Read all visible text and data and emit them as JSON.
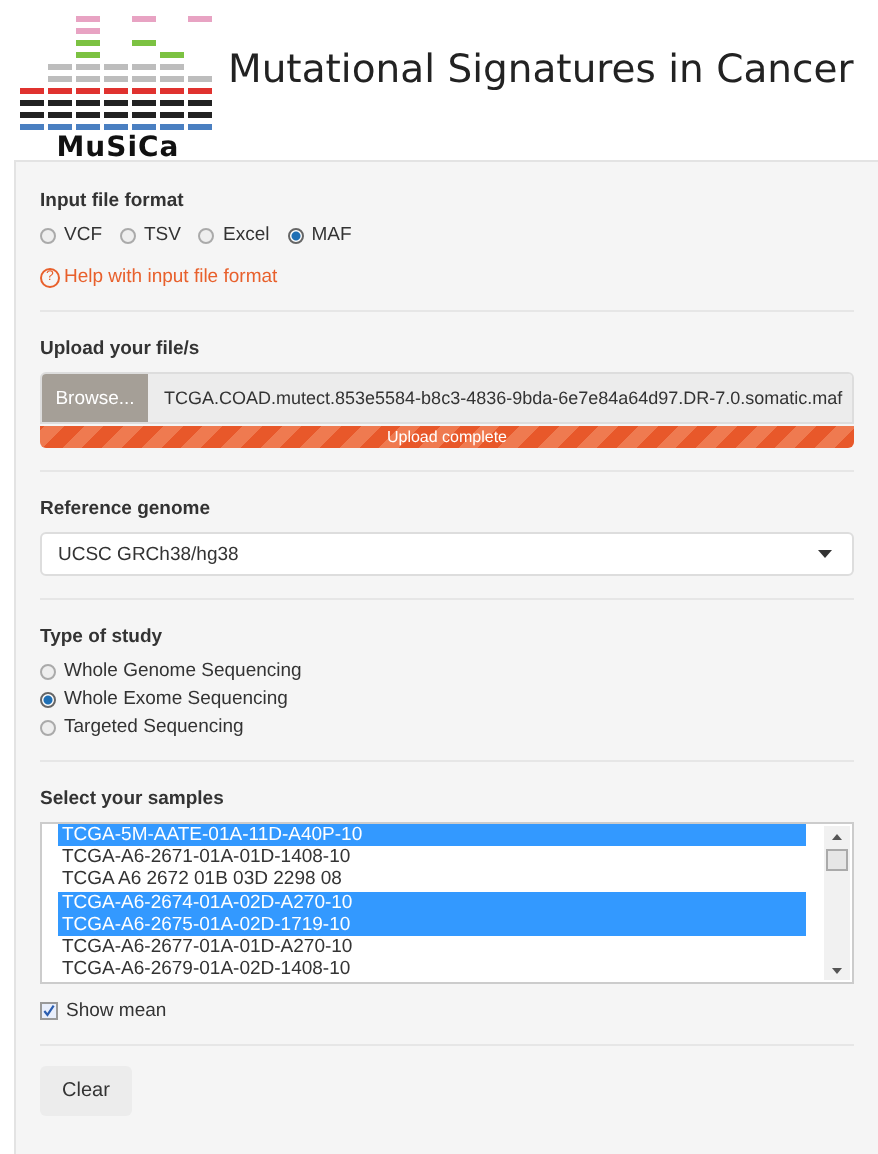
{
  "header": {
    "logo_text": "MuSiCa",
    "title": "Mutational Signatures in Cancer"
  },
  "input_format": {
    "label": "Input file format",
    "options": [
      {
        "label": "VCF",
        "selected": false
      },
      {
        "label": "TSV",
        "selected": false
      },
      {
        "label": "Excel",
        "selected": false
      },
      {
        "label": "MAF",
        "selected": true
      }
    ],
    "help_icon": "?",
    "help_link": "Help with input file format"
  },
  "upload": {
    "label": "Upload your file/s",
    "button": "Browse...",
    "file_name": "TCGA.COAD.mutect.853e5584-b8c3-4836-9bda-6e7e84a64d97.DR-7.0.somatic.maf",
    "progress": {
      "level": 1,
      "text": "Upload complete"
    }
  },
  "reference_genome": {
    "label": "Reference genome",
    "value": "UCSC GRCh38/hg38"
  },
  "study_type": {
    "label": "Type of study",
    "options": [
      {
        "label": "Whole Genome Sequencing",
        "selected": false
      },
      {
        "label": "Whole Exome Sequencing",
        "selected": true
      },
      {
        "label": "Targeted Sequencing",
        "selected": false
      }
    ]
  },
  "samples": {
    "label": "Select your samples",
    "items": [
      {
        "label": "TCGA-5M-AATE-01A-11D-A40P-10",
        "selected": true
      },
      {
        "label": "TCGA-A6-2671-01A-01D-1408-10",
        "selected": false
      },
      {
        "label": "TCGA A6 2672 01B 03D 2298 08",
        "selected": false
      },
      {
        "label": "TCGA-A6-2674-01A-02D-A270-10",
        "selected": true
      },
      {
        "label": "TCGA-A6-2675-01A-02D-1719-10",
        "selected": true
      },
      {
        "label": "TCGA-A6-2677-01A-01D-A270-10",
        "selected": false
      },
      {
        "label": "TCGA-A6-2679-01A-02D-1408-10",
        "selected": false
      }
    ]
  },
  "show_mean": {
    "label": "Show mean",
    "checked": true
  },
  "buttons": [
    "Clear"
  ]
}
